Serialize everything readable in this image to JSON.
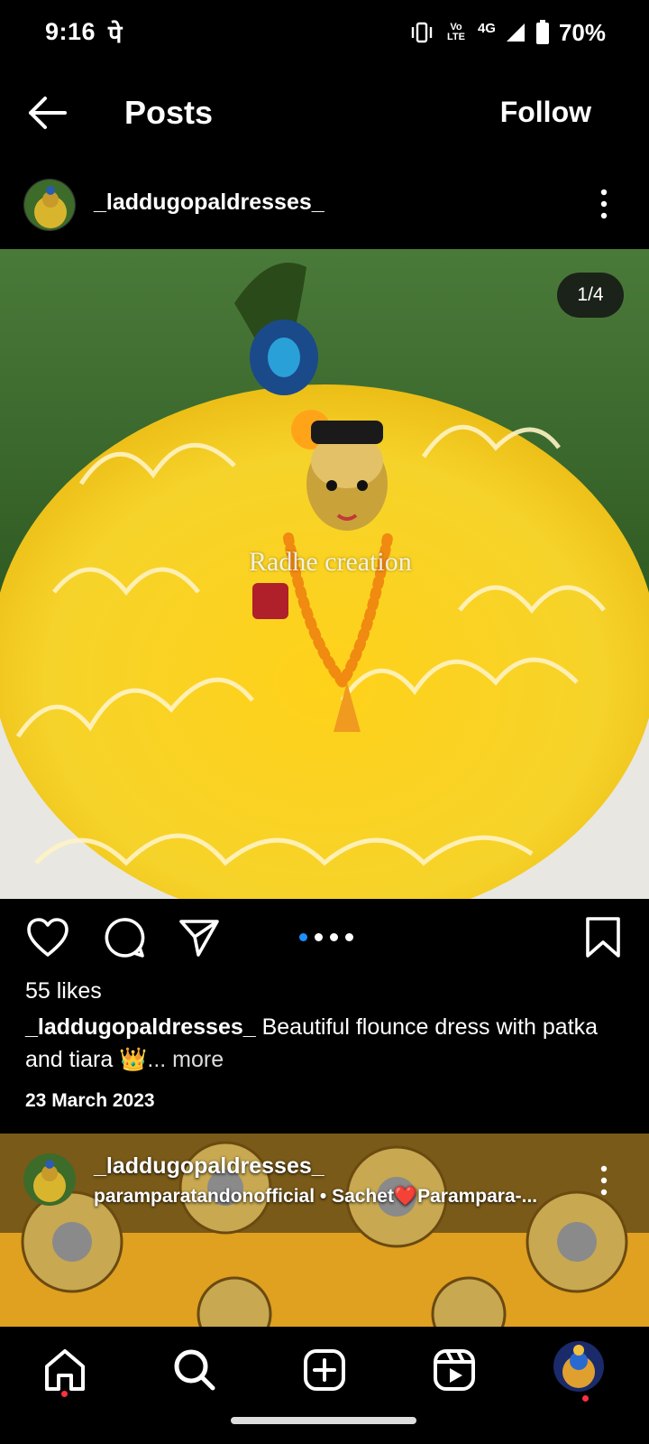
{
  "status_bar": {
    "time": "9:16",
    "carrier_glyph": "पे",
    "network": "4G",
    "lte_top": "Vo",
    "lte_bottom": "LTE",
    "battery": "70%"
  },
  "header": {
    "title": "Posts",
    "follow_label": "Follow"
  },
  "post": {
    "username": "_laddugopaldresses_",
    "counter": "1/4",
    "watermark": "Radhe creation",
    "likes": "55 likes",
    "caption_user": "_laddugopaldresses_",
    "caption_text": " Beautiful flounce dress with patka and tiara 👑",
    "caption_more": "... more",
    "date": "23 March 2023",
    "carousel_total": 4,
    "carousel_index": 1
  },
  "next_post": {
    "username": "_laddugopaldresses_",
    "subtitle": "paramparatandonofficial • Sachet❤️Parampara-..."
  },
  "icons": {
    "back": "arrow-left-icon",
    "kebab": "more-vertical-icon",
    "like": "heart-icon",
    "comment": "comment-icon",
    "share": "send-icon",
    "save": "bookmark-icon",
    "home": "home-icon",
    "search": "search-icon",
    "create": "plus-square-icon",
    "reels": "reels-icon",
    "profile": "avatar"
  },
  "colors": {
    "background": "#000000",
    "accent_dot": "#1f8eff",
    "notification": "#ff3040",
    "dress_yellow": "#f7d21a"
  }
}
